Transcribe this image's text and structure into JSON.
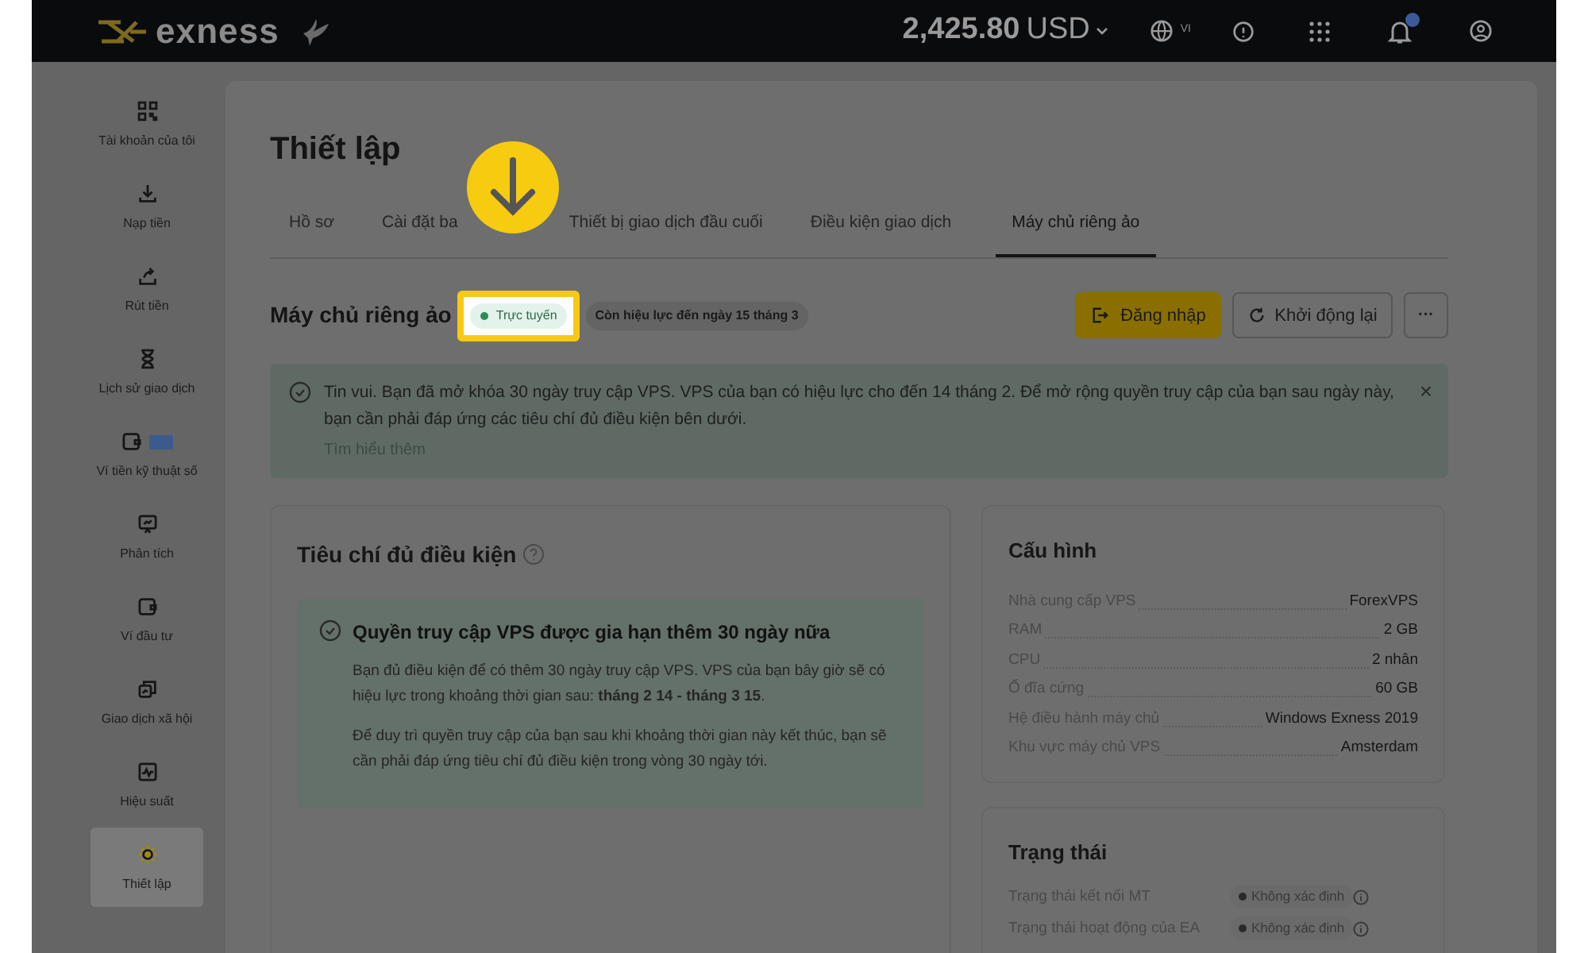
{
  "header": {
    "brand": "exness",
    "balance": "2,425.80",
    "currency": "USD",
    "language": "VI",
    "notification_dot": true
  },
  "sidebar": {
    "items": [
      {
        "label": "Tài khoản của tôi",
        "selected": false
      },
      {
        "label": "Nạp tiền",
        "selected": false
      },
      {
        "label": "Rút tiền",
        "selected": false
      },
      {
        "label": "Lịch sử giao dịch",
        "selected": false
      },
      {
        "label": "Ví tiền kỹ thuật số",
        "badge": true,
        "selected": false
      },
      {
        "label": "Phân tích",
        "selected": false
      },
      {
        "label": "Ví đầu tư",
        "selected": false
      },
      {
        "label": "Giao dịch xã hội",
        "selected": false
      },
      {
        "label": "Hiệu suất",
        "selected": false
      },
      {
        "label": "Thiết lập",
        "selected": true
      }
    ]
  },
  "page_title": "Thiết lập",
  "tabs": [
    {
      "label": "Hồ sơ",
      "selected": false
    },
    {
      "label": "Cài đặt ba",
      "selected": false
    },
    {
      "label": "Thiết bị giao dịch đầu cuối",
      "selected": false
    },
    {
      "label": "Điều kiện giao dịch",
      "selected": false
    },
    {
      "label": "Máy chủ riêng ảo",
      "selected": true
    }
  ],
  "vps": {
    "title": "Máy chủ riêng ảo",
    "status": "Trực tuyến",
    "validity": "Còn hiệu lực đến ngày 15 tháng 3",
    "login_button": "Đăng nhập",
    "restart_button": "Khởi động lại",
    "more_button": "···"
  },
  "banner": {
    "text": "Tin vui. Bạn đã mở khóa 30 ngày truy cập VPS. VPS của bạn có hiệu lực cho đến 14 tháng 2. Để mở rộng quyền truy cập của bạn sau ngày này, bạn cần phải đáp ứng các tiêu chí đủ điều kiện bên dưới.",
    "link": "Tìm hiểu thêm",
    "close": "×"
  },
  "eligibility": {
    "title": "Tiêu chí đủ điều kiện",
    "notice_title": "Quyền truy cập VPS được gia hạn thêm 30 ngày nữa",
    "paragraphs": [
      "Bạn đủ điều kiện để có thêm 30 ngày truy cập VPS. VPS của bạn bây giờ sẽ có hiệu lực trong khoảng thời gian sau: **tháng 2 14 - tháng 3 15**.",
      "Để duy trì quyền truy cập của bạn sau khi khoảng thời gian này kết thúc, bạn sẽ cần phải đáp ứng tiêu chí đủ điều kiện trong vòng 30 ngày tới."
    ]
  },
  "configuration": {
    "title": "Cấu hình",
    "rows": [
      {
        "label": "Nhà cung cấp VPS",
        "value": "ForexVPS"
      },
      {
        "label": "RAM",
        "value": "2 GB"
      },
      {
        "label": "CPU",
        "value": "2 nhân"
      },
      {
        "label": "Ổ đĩa cứng",
        "value": "60 GB"
      },
      {
        "label": "Hệ điều hành máy chủ",
        "value": "Windows Exness 2019"
      },
      {
        "label": "Khu vực máy chủ VPS",
        "value": "Amsterdam"
      }
    ]
  },
  "status": {
    "title": "Trạng thái",
    "rows": [
      {
        "label": "Trạng thái kết nối MT",
        "value": "Không xác định"
      },
      {
        "label": "Trạng thái hoạt động của EA",
        "value": "Không xác định"
      }
    ]
  }
}
